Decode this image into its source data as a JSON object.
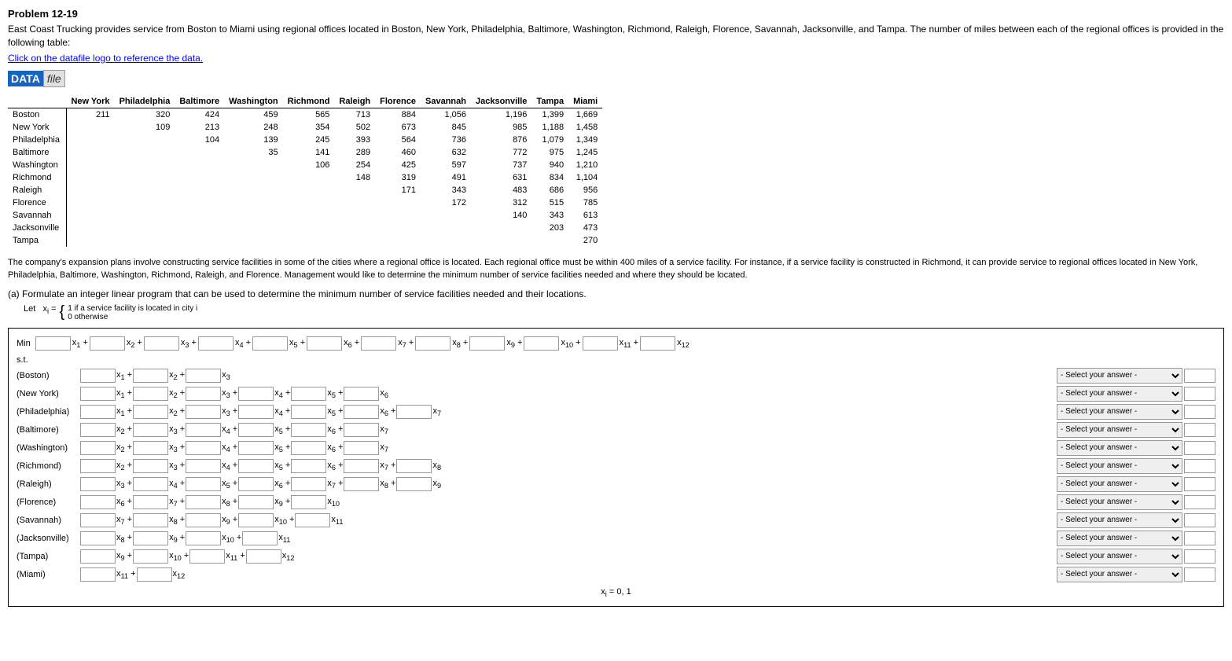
{
  "problem": {
    "title": "Problem 12-19",
    "description": "East Coast Trucking provides service from Boston to Miami using regional offices located in Boston, New York, Philadelphia, Baltimore, Washington, Richmond, Raleigh, Florence, Savannah, Jacksonville, and Tampa. The number of miles between each of the regional offices is provided in the following table:",
    "data_link": "Click on the datafile logo to reference the data.",
    "logo": {
      "data": "DATA",
      "file": "file"
    }
  },
  "table": {
    "headers": [
      "",
      "New York",
      "Philadelphia",
      "Baltimore",
      "Washington",
      "Richmond",
      "Raleigh",
      "Florence",
      "Savannah",
      "Jacksonville",
      "Tampa",
      "Miami"
    ],
    "rows": [
      [
        "Boston",
        "211",
        "320",
        "424",
        "459",
        "565",
        "713",
        "884",
        "1,056",
        "1,196",
        "1,399",
        "1,669"
      ],
      [
        "New York",
        "",
        "109",
        "213",
        "248",
        "354",
        "502",
        "673",
        "845",
        "985",
        "1,188",
        "1,458"
      ],
      [
        "Philadelphia",
        "",
        "",
        "104",
        "139",
        "245",
        "393",
        "564",
        "736",
        "876",
        "1,079",
        "1,349"
      ],
      [
        "Baltimore",
        "",
        "",
        "",
        "35",
        "141",
        "289",
        "460",
        "632",
        "772",
        "975",
        "1,245"
      ],
      [
        "Washington",
        "",
        "",
        "",
        "",
        "106",
        "254",
        "425",
        "597",
        "737",
        "940",
        "1,210"
      ],
      [
        "Richmond",
        "",
        "",
        "",
        "",
        "",
        "148",
        "319",
        "491",
        "631",
        "834",
        "1,104"
      ],
      [
        "Raleigh",
        "",
        "",
        "",
        "",
        "",
        "",
        "171",
        "343",
        "483",
        "686",
        "956"
      ],
      [
        "Florence",
        "",
        "",
        "",
        "",
        "",
        "",
        "",
        "172",
        "312",
        "515",
        "785"
      ],
      [
        "Savannah",
        "",
        "",
        "",
        "",
        "",
        "",
        "",
        "",
        "140",
        "343",
        "613"
      ],
      [
        "Jacksonville",
        "",
        "",
        "",
        "",
        "",
        "",
        "",
        "",
        "",
        "203",
        "473"
      ],
      [
        "Tampa",
        "",
        "",
        "",
        "",
        "",
        "",
        "",
        "",
        "",
        "",
        "270"
      ]
    ]
  },
  "section_text": "The company's expansion plans involve constructing service facilities in some of the cities where a regional office is located. Each regional office must be within 400 miles of a service facility. For instance, if a service facility is constructed in Richmond, it can provide service to regional offices located in New York, Philadelphia, Baltimore, Washington, Richmond, Raleigh, and Florence. Management would like to determine the minimum number of service facilities needed and where they should be located.",
  "part_a": {
    "label": "(a) Formulate an integer linear program that can be used to determine the minimum number of service facilities needed and their locations.",
    "let_def": "Let  x_i =",
    "brace_lines": [
      "1 if a service facility is located in city i",
      "0 otherwise"
    ],
    "min_label": "Min",
    "variables": [
      "x1",
      "x2",
      "x3",
      "x4",
      "x5",
      "x6",
      "x7",
      "x8",
      "x9",
      "x10",
      "x11",
      "x12"
    ],
    "st_label": "s.t.",
    "constraints": [
      {
        "label": "(Boston)",
        "terms": [
          [
            "x1",
            "+"
          ],
          [
            "x2",
            "+"
          ],
          [
            "x3",
            ""
          ]
        ],
        "select_label": "- Select your answer -",
        "answer_val": ""
      },
      {
        "label": "(New York)",
        "terms": [
          [
            "x1",
            "+"
          ],
          [
            "x2",
            "+"
          ],
          [
            "x3",
            "+"
          ],
          [
            "x4",
            "+"
          ],
          [
            "x5",
            "+"
          ],
          [
            "x6",
            ""
          ]
        ],
        "select_label": "- Select your answer -",
        "answer_val": ""
      },
      {
        "label": "(Philadelphia)",
        "terms": [
          [
            "x1",
            "+"
          ],
          [
            "x2",
            "+"
          ],
          [
            "x3",
            "+"
          ],
          [
            "x4",
            "+"
          ],
          [
            "x5",
            "+"
          ],
          [
            "x6",
            "+"
          ],
          [
            "x7",
            ""
          ]
        ],
        "select_label": "- Select your answer -",
        "answer_val": ""
      },
      {
        "label": "(Baltimore)",
        "terms": [
          [
            "x2",
            "+"
          ],
          [
            "x3",
            "+"
          ],
          [
            "x4",
            "+"
          ],
          [
            "x5",
            "+"
          ],
          [
            "x6",
            "+"
          ],
          [
            "x7",
            ""
          ]
        ],
        "select_label": "- Select your answer -",
        "answer_val": ""
      },
      {
        "label": "(Washington)",
        "terms": [
          [
            "x2",
            "+"
          ],
          [
            "x3",
            "+"
          ],
          [
            "x4",
            "+"
          ],
          [
            "x5",
            "+"
          ],
          [
            "x6",
            "+"
          ],
          [
            "x7",
            ""
          ]
        ],
        "select_label": "- Select your answer -",
        "answer_val": ""
      },
      {
        "label": "(Richmond)",
        "terms": [
          [
            "x2",
            "+"
          ],
          [
            "x3",
            "+"
          ],
          [
            "x4",
            "+"
          ],
          [
            "x5",
            "+"
          ],
          [
            "x6",
            "+"
          ],
          [
            "x7",
            "+"
          ],
          [
            "x8",
            ""
          ]
        ],
        "select_label": "- Select your answer -",
        "answer_val": ""
      },
      {
        "label": "(Raleigh)",
        "terms": [
          [
            "x3",
            "+"
          ],
          [
            "x4",
            "+"
          ],
          [
            "x5",
            "+"
          ],
          [
            "x6",
            "+"
          ],
          [
            "x7",
            "+"
          ],
          [
            "x8",
            "+"
          ],
          [
            "x9",
            ""
          ]
        ],
        "select_label": "- Select your answer -",
        "answer_val": ""
      },
      {
        "label": "(Florence)",
        "terms": [
          [
            "x6",
            "+"
          ],
          [
            "x7",
            "+"
          ],
          [
            "x8",
            "+"
          ],
          [
            "x9",
            "+"
          ],
          [
            "x10",
            ""
          ]
        ],
        "select_label": "- Select your answer -",
        "answer_val": ""
      },
      {
        "label": "(Savannah)",
        "terms": [
          [
            "x7",
            "+"
          ],
          [
            "x8",
            "+"
          ],
          [
            "x9",
            "+"
          ],
          [
            "x10",
            "+"
          ],
          [
            "x11",
            ""
          ]
        ],
        "select_label": "- Select your answer -",
        "answer_val": ""
      },
      {
        "label": "(Jacksonville)",
        "terms": [
          [
            "x8",
            "+"
          ],
          [
            "x9",
            "+"
          ],
          [
            "x10",
            "+"
          ],
          [
            "x11",
            ""
          ]
        ],
        "select_label": "- Select your answer -",
        "answer_val": ""
      },
      {
        "label": "(Tampa)",
        "terms": [
          [
            "x9",
            "+"
          ],
          [
            "x10",
            "+"
          ],
          [
            "x11",
            "+"
          ],
          [
            "x12",
            ""
          ]
        ],
        "select_label": "- Select your answer -",
        "answer_val": ""
      },
      {
        "label": "(Miami)",
        "terms": [
          [
            "x11",
            "+"
          ],
          [
            "x12",
            ""
          ]
        ],
        "select_label": "- Select your answer -",
        "answer_val": ""
      }
    ],
    "domain": "x_i = 0, 1",
    "select_options": [
      "- Select your answer -",
      "≥",
      "≤",
      "="
    ]
  }
}
